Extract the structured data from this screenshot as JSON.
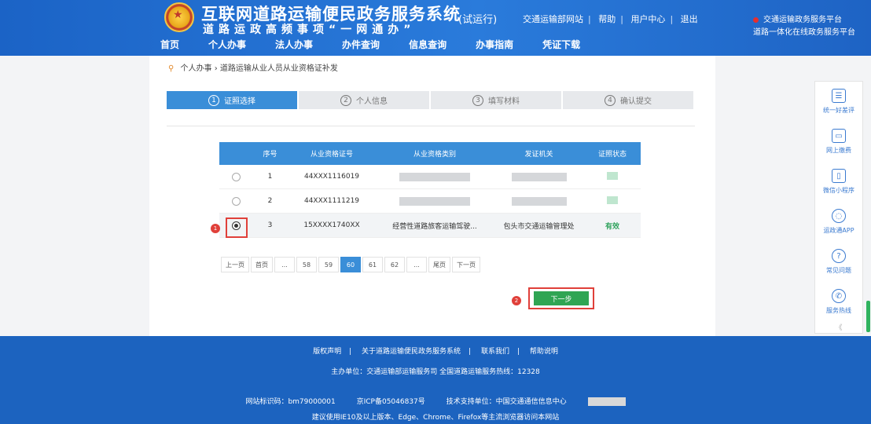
{
  "header": {
    "title": "互联网道路运输便民政务服务系统",
    "trial": "(试运行)",
    "slogan": "道路运政高频事项“一网通办”",
    "links": [
      "交通运输部网站",
      "帮助",
      "用户中心",
      "退出"
    ],
    "notice1": "交通运输政务服务平台",
    "notice2": "道路一体化在线政务服务平台",
    "nav": [
      "首页",
      "个人办事",
      "法人办事",
      "办件查询",
      "信息查询",
      "办事指南",
      "凭证下载"
    ]
  },
  "breadcrumb": {
    "home": "个人办事",
    "current": "道路运输从业人员从业资格证补发"
  },
  "steps": [
    {
      "num": "1",
      "label": "证照选择"
    },
    {
      "num": "2",
      "label": "个人信息"
    },
    {
      "num": "3",
      "label": "填写材料"
    },
    {
      "num": "4",
      "label": "确认提交"
    }
  ],
  "table": {
    "headers": [
      "序号",
      "从业资格证号",
      "从业资格类别",
      "发证机关",
      "证照状态"
    ],
    "rows": [
      {
        "idx": "1",
        "cert": "44XXX1116019",
        "category": "",
        "authority": "",
        "status": ""
      },
      {
        "idx": "2",
        "cert": "44XXX1111219",
        "category": "",
        "authority": "",
        "status": ""
      },
      {
        "idx": "3",
        "cert": "15XXXX1740XX",
        "category": "经营性道路旅客运输驾驶...",
        "authority": "包头市交通运输管理处",
        "status": "有效"
      }
    ]
  },
  "annotations": {
    "a1": "1",
    "a2": "2"
  },
  "pager": [
    "上一页",
    "首页",
    "...",
    "58",
    "59",
    "60",
    "61",
    "62",
    "...",
    "尾页",
    "下一页"
  ],
  "next_button": "下一步",
  "sidebar": [
    {
      "icon": "list-icon",
      "label": "统一好差评"
    },
    {
      "icon": "card-icon",
      "label": "网上缴费"
    },
    {
      "icon": "phone-icon",
      "label": "微信小程序"
    },
    {
      "icon": "app-icon",
      "label": "运政通APP"
    },
    {
      "icon": "question-icon",
      "label": "常见问题"
    },
    {
      "icon": "call-icon",
      "label": "服务热线"
    }
  ],
  "sidebar_collapse": "《",
  "footer": {
    "links": [
      "版权声明",
      "关于道路运输便民政务服务系统",
      "联系我们",
      "帮助说明"
    ],
    "line2": "主办单位：交通运输部运输服务司    全国道路运输服务热线：12328",
    "line3": [
      "网站标识码：bm79000001",
      "京ICP备05046837号",
      "技术支持单位：中国交通通信信息中心"
    ],
    "line4": "建议使用IE10及以上版本、Edge、Chrome、Firefox等主流浏览器访问本网站"
  },
  "colors": {
    "header": "#1f6acb",
    "accent": "#3a8ed8",
    "green": "#2fa553",
    "red": "#e0403a"
  }
}
